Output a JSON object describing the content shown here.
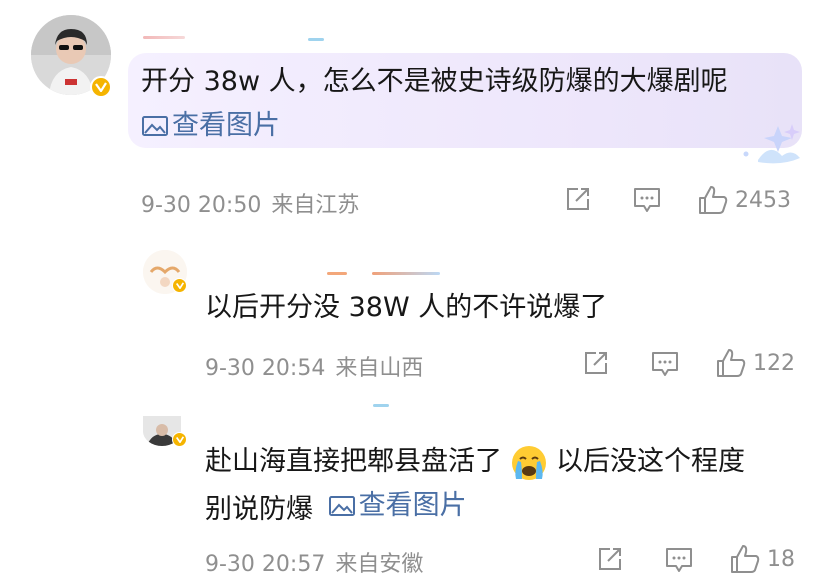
{
  "comments": [
    {
      "text": "开分 38w 人，怎么不是被史诗级防爆的大爆剧呢",
      "view_image": "查看图片",
      "date": "9-30 20:50",
      "source": "来自江苏",
      "likes": "2453"
    },
    {
      "text": "以后开分没 38W 人的不许说爆了",
      "date": "9-30 20:54",
      "source": "来自山西",
      "likes": "122"
    },
    {
      "text_line1_a": "赴山海直接把郫县盘活了",
      "text_line1_b": "以后没这个程度",
      "text_line2": "别说防爆",
      "view_image": "查看图片",
      "date": "9-30 20:57",
      "source": "来自安徽",
      "likes": "18"
    }
  ],
  "colors": {
    "badge": "#f5b400",
    "link": "#4a6fa5",
    "meta": "#8f8f8f",
    "bubble": "#efe8fc"
  }
}
